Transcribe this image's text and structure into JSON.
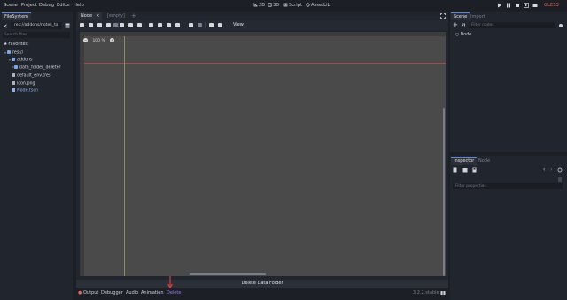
{
  "menu": [
    "Scene",
    "Project",
    "Debug",
    "Editor",
    "Help"
  ],
  "workspaces": [
    {
      "label": "2D",
      "icon": "2d-icon"
    },
    {
      "label": "3D",
      "icon": "3d-icon"
    },
    {
      "label": "Script",
      "icon": "script-icon"
    },
    {
      "label": "AssetLib",
      "icon": "assetlib-icon"
    }
  ],
  "renderer": "GLES3",
  "filesystem": {
    "tab": "FileSystem",
    "path": "res://addons/notes_ta",
    "search_placeholder": "Search files",
    "tree": [
      {
        "label": "Favorites:",
        "kind": "favorites",
        "indent": 0
      },
      {
        "label": "res://",
        "kind": "folder",
        "indent": 0
      },
      {
        "label": "addons",
        "kind": "folder",
        "indent": 1
      },
      {
        "label": "data_folder_deleter",
        "kind": "folder",
        "indent": 2
      },
      {
        "label": "default_env.tres",
        "kind": "file",
        "indent": 1
      },
      {
        "label": "icon.png",
        "kind": "file",
        "indent": 1
      },
      {
        "label": "Node.tscn",
        "kind": "file",
        "indent": 1,
        "selected": true
      }
    ]
  },
  "scene_tabs": [
    {
      "label": "Node",
      "active": true
    },
    {
      "label": "[empty]",
      "active": false
    }
  ],
  "toolbar": {
    "view_label": "View"
  },
  "viewport": {
    "zoom_label": "100 %"
  },
  "bottom_panel": {
    "title": "Delete Data Folder",
    "tabs": [
      "Output",
      "Debugger",
      "Audio",
      "Animation",
      "Delete"
    ],
    "version": "3.2.2.stable"
  },
  "scene_dock": {
    "tabs": [
      "Scene",
      "Import"
    ],
    "filter_placeholder": "Filter nodes",
    "root_node": "Node"
  },
  "inspector": {
    "tabs": [
      "Inspector",
      "Node"
    ],
    "filter_placeholder": "Filter properties"
  },
  "colors": {
    "accent": "#5e8ad6",
    "delete_tab": "#9a7fe0",
    "renderer": "#e0625a"
  }
}
